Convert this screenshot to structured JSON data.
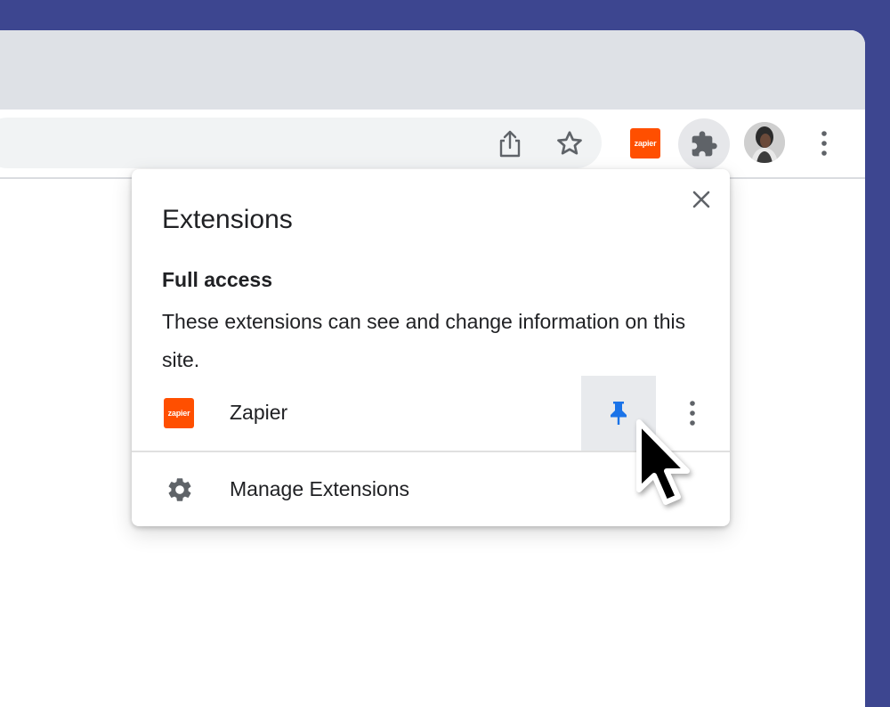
{
  "toolbar": {
    "zapier_badge": "zapier",
    "icons": [
      "share-icon",
      "star-icon",
      "zapier-extension-icon",
      "puzzle-icon",
      "avatar",
      "more-vert-icon"
    ]
  },
  "popup": {
    "title": "Extensions",
    "close_icon": "close-icon",
    "section_heading": "Full access",
    "section_description": "These extensions can see and change information on this site.",
    "extension": {
      "logo_text": "zapier",
      "name": "Zapier",
      "pin_icon": "pin-icon",
      "menu_icon": "more-vert-icon"
    },
    "manage_label": "Manage Extensions",
    "manage_icon": "gear-icon"
  },
  "colors": {
    "background": "#3d4690",
    "zapier_orange": "#ff4f00",
    "pin_blue": "#1a73e8"
  }
}
